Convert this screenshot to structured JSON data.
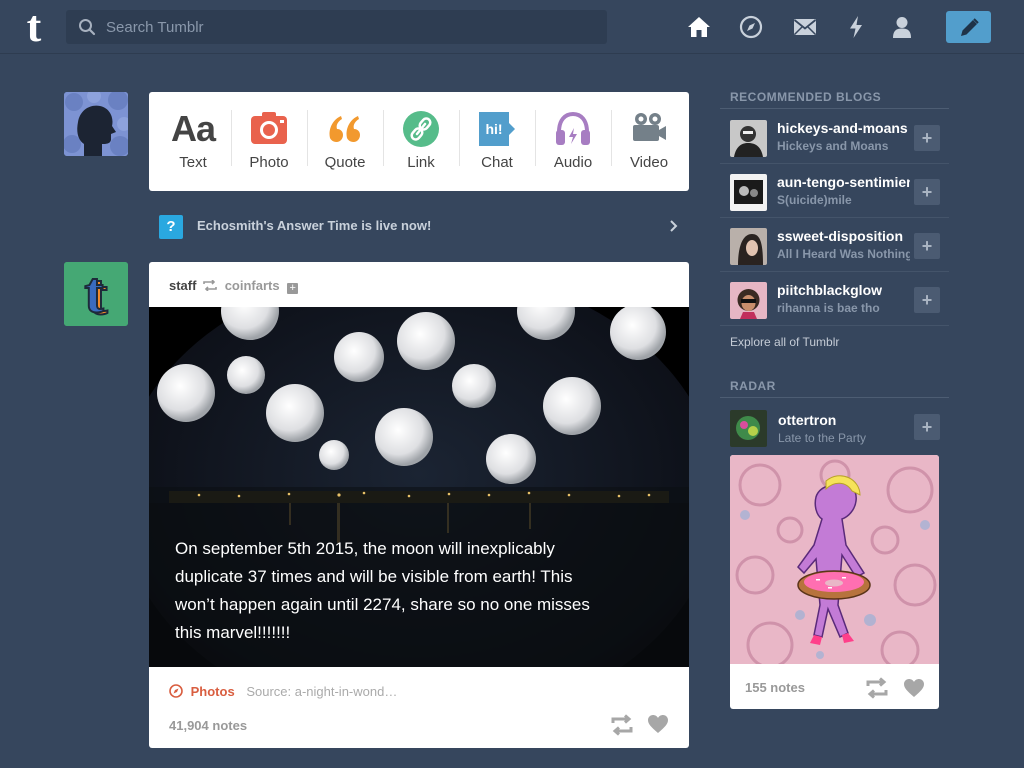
{
  "header": {
    "logo": "t",
    "search_placeholder": "Search Tumblr",
    "nav_icons": [
      "home-icon",
      "explore-icon",
      "inbox-icon",
      "activity-icon",
      "account-icon"
    ],
    "compose_icon": "pencil-icon",
    "accent": "#529ecc"
  },
  "post_types": [
    {
      "label": "Text",
      "icon": "text-icon"
    },
    {
      "label": "Photo",
      "icon": "photo-icon",
      "color": "#e9624d"
    },
    {
      "label": "Quote",
      "icon": "quote-icon",
      "color": "#f2992e"
    },
    {
      "label": "Link",
      "icon": "link-icon",
      "color": "#56bc8a"
    },
    {
      "label": "Chat",
      "icon": "chat-icon",
      "color": "#529ecc"
    },
    {
      "label": "Audio",
      "icon": "audio-icon",
      "color": "#a77dc2"
    },
    {
      "label": "Video",
      "icon": "video-icon",
      "color": "#748089"
    }
  ],
  "banner": {
    "icon": "?",
    "text": "Echosmith's Answer Time is live now!"
  },
  "post": {
    "author": "staff",
    "reblogged_from": "coinfarts",
    "caption": "On september 5th 2015, the moon will inexplicably duplicate 37 times and will be visible from earth! This won’t happen again until 2274, share so no one misses this marvel!!!!!!!",
    "type_tag": "Photos",
    "source": "Source: a-night-in-wond…",
    "notes": "41,904 notes"
  },
  "sidebar": {
    "recommended_title": "RECOMMENDED BLOGS",
    "blogs": [
      {
        "name": "hickeys-and-moans",
        "desc": "Hickeys and Moans"
      },
      {
        "name": "aun-tengo-sentimientos",
        "desc": "S(uicide)mile"
      },
      {
        "name": "ssweet-disposition",
        "desc": "All I Heard Was Nothing"
      },
      {
        "name": "piitchblackglow",
        "desc": "rihanna is bae tho"
      }
    ],
    "follow_label": "+",
    "explore": "Explore all of Tumblr",
    "radar_title": "RADAR",
    "radar": {
      "name": "ottertron",
      "desc": "Late to the Party",
      "notes": "155 notes"
    }
  }
}
